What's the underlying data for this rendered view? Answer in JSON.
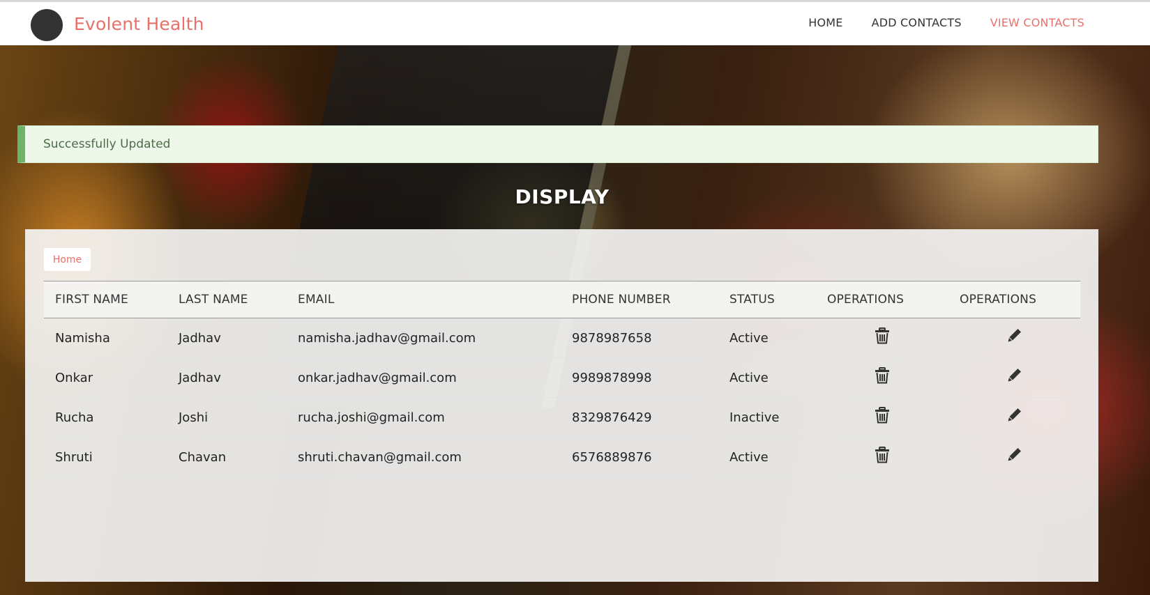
{
  "navbar": {
    "brand": "Evolent Health",
    "links": [
      {
        "label": "HOME",
        "active": false
      },
      {
        "label": "ADD CONTACTS",
        "active": false
      },
      {
        "label": "VIEW CONTACTS",
        "active": true
      }
    ]
  },
  "alert": {
    "message": "Successfully Updated"
  },
  "page": {
    "title": "DISPLAY"
  },
  "breadcrumb": {
    "home": "Home"
  },
  "table": {
    "headers": [
      "FIRST NAME",
      "LAST NAME",
      "EMAIL",
      "PHONE NUMBER",
      "STATUS",
      "OPERATIONS",
      "OPERATIONS"
    ],
    "rows": [
      {
        "first": "Namisha",
        "last": "Jadhav",
        "email": "namisha.jadhav@gmail.com",
        "phone": "9878987658",
        "status": "Active"
      },
      {
        "first": "Onkar",
        "last": "Jadhav",
        "email": "onkar.jadhav@gmail.com",
        "phone": "9989878998",
        "status": "Active"
      },
      {
        "first": "Rucha",
        "last": "Joshi",
        "email": "rucha.joshi@gmail.com",
        "phone": "8329876429",
        "status": "Inactive"
      },
      {
        "first": "Shruti",
        "last": "Chavan",
        "email": "shruti.chavan@gmail.com",
        "phone": "6576889876",
        "status": "Active"
      }
    ],
    "row_icons": {
      "delete": "trash-icon",
      "edit": "pencil-icon"
    }
  },
  "colors": {
    "accent": "#e9706a",
    "alert_bg": "#eef8ea",
    "alert_border": "#6fb36a",
    "nav_text": "#333333"
  }
}
